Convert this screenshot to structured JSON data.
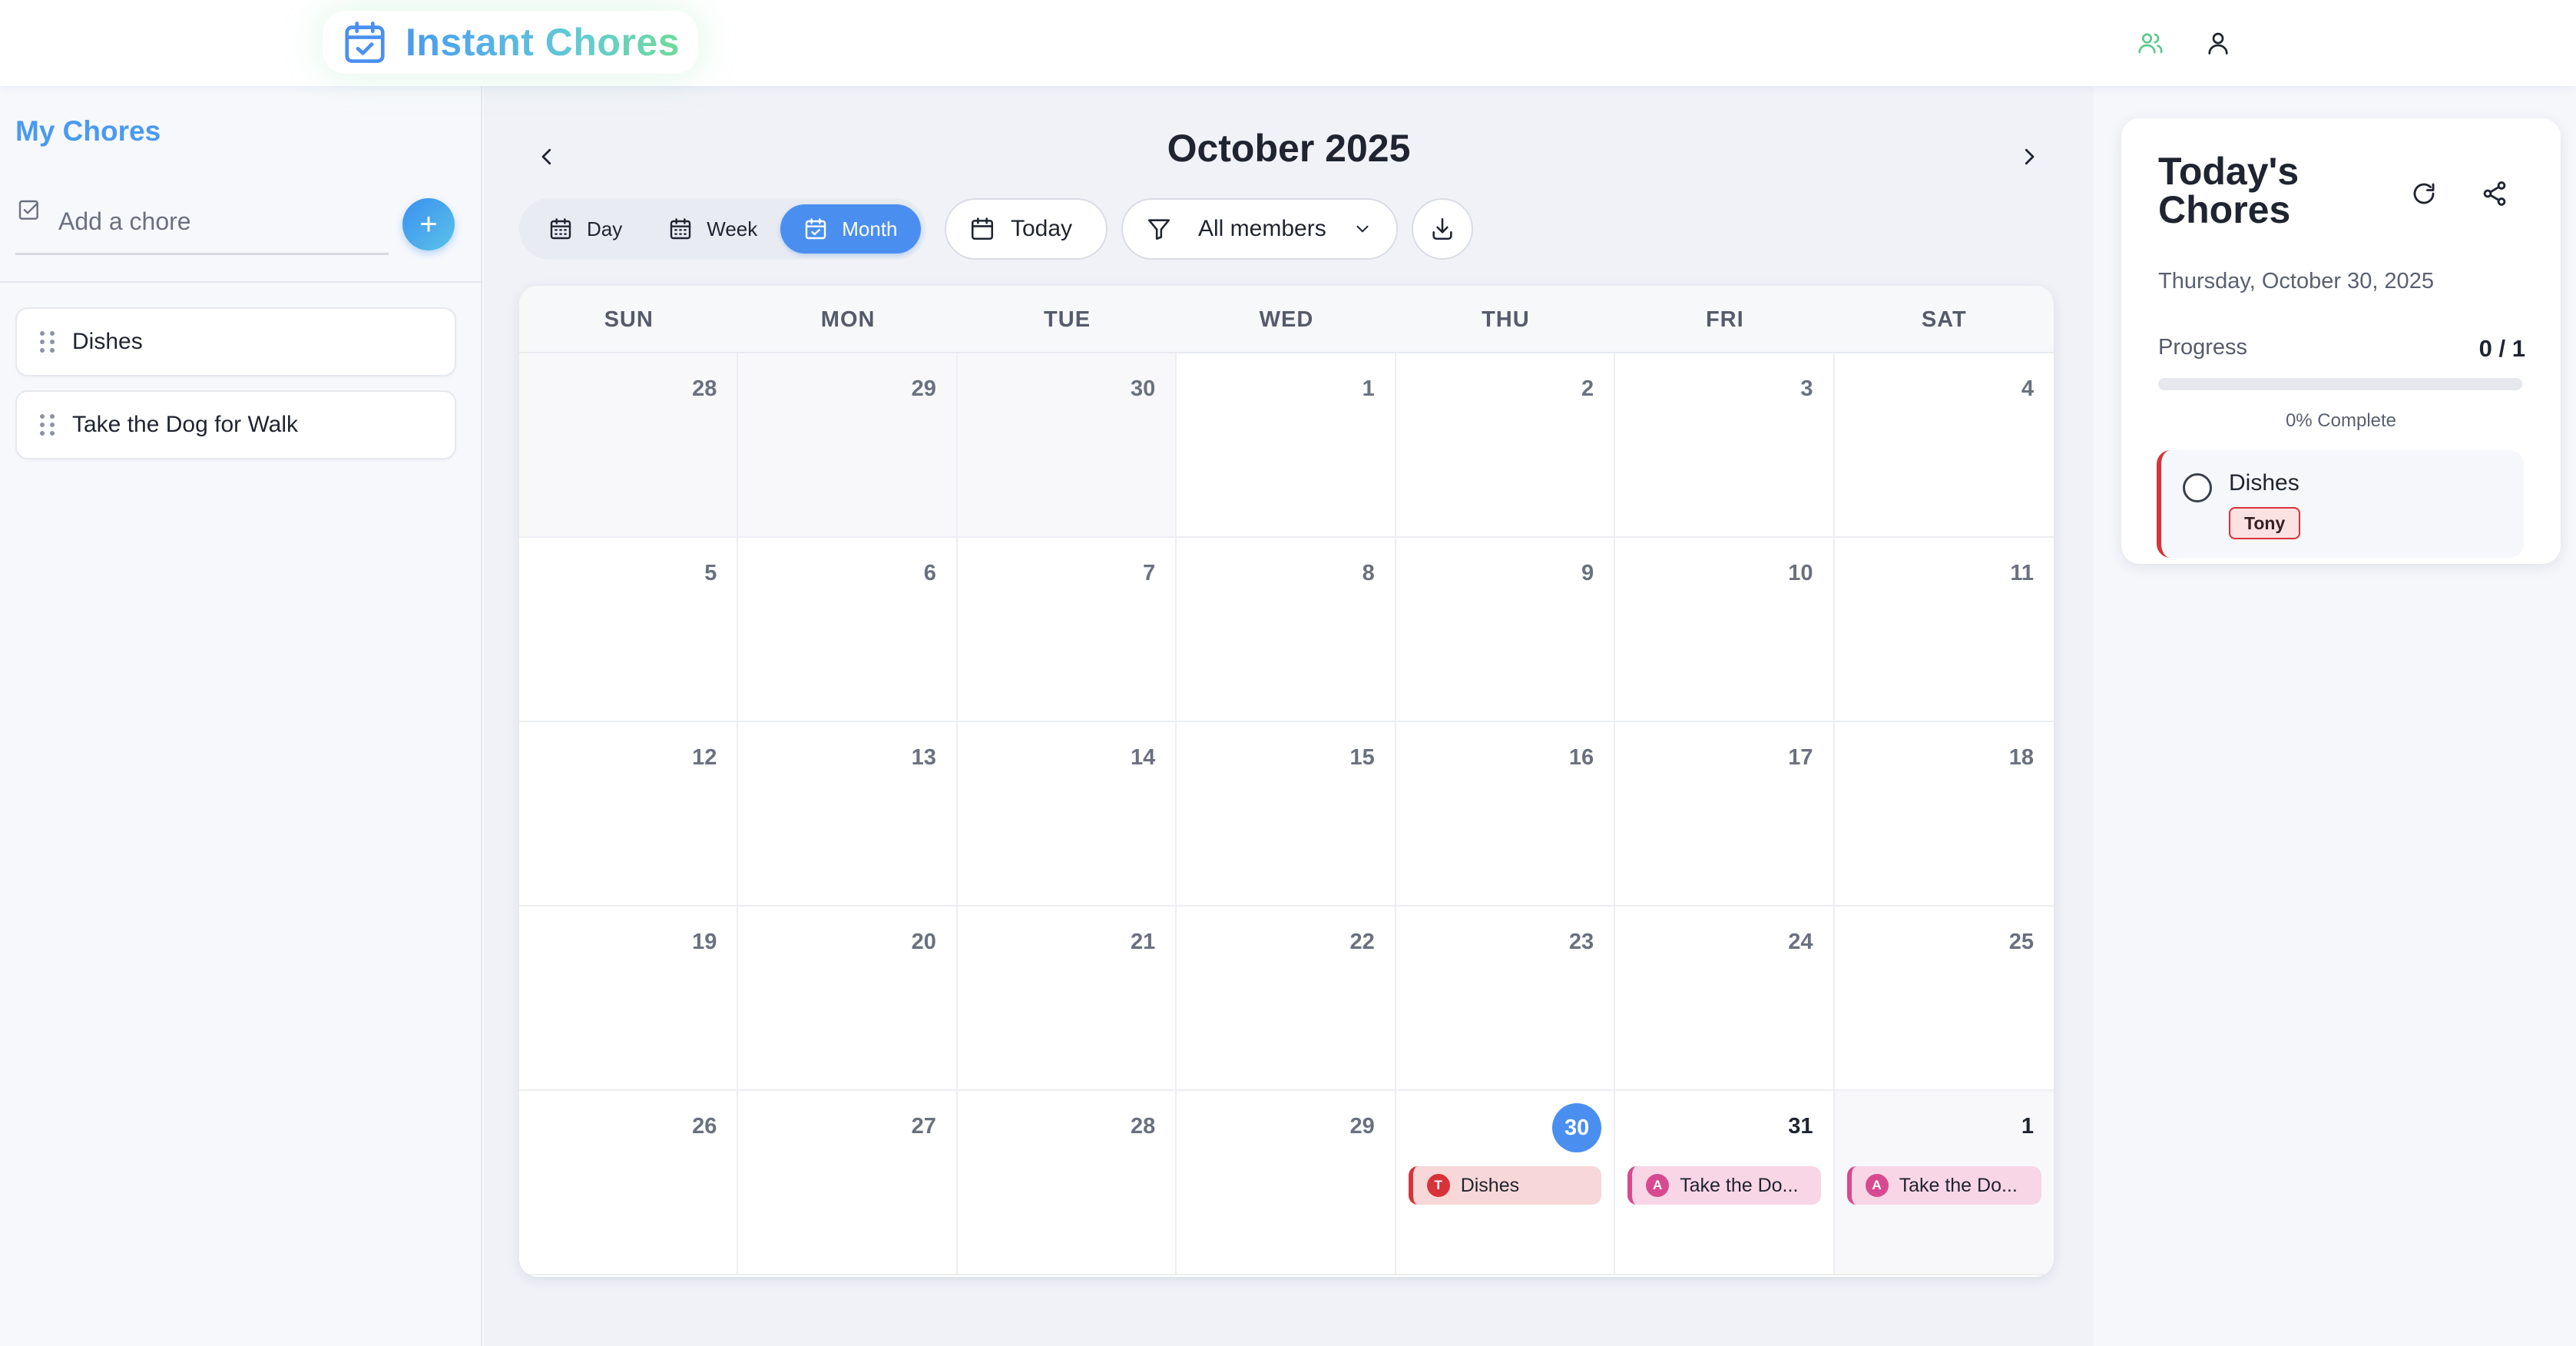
{
  "app": {
    "title": "Instant Chores"
  },
  "colors": {
    "accent": "#4a8ff0",
    "brand_green": "#6edc9a",
    "event_red": "#d8323a",
    "event_pink": "#d84a8f"
  },
  "sidebar": {
    "title": "My Chores",
    "add_placeholder": "Add a chore",
    "add_button": "+",
    "chores": [
      {
        "label": "Dishes"
      },
      {
        "label": "Take the Dog for Walk"
      }
    ]
  },
  "calendar": {
    "month_title": "October 2025",
    "views": {
      "day": "Day",
      "week": "Week",
      "month": "Month"
    },
    "active_view": "Month",
    "today_button": "Today",
    "filter_label": "All members",
    "weekdays": [
      "SUN",
      "MON",
      "TUE",
      "WED",
      "THU",
      "FRI",
      "SAT"
    ],
    "weeks": [
      [
        {
          "d": "28",
          "m": "prev"
        },
        {
          "d": "29",
          "m": "prev"
        },
        {
          "d": "30",
          "m": "prev"
        },
        {
          "d": "1",
          "m": "cur"
        },
        {
          "d": "2",
          "m": "cur"
        },
        {
          "d": "3",
          "m": "cur"
        },
        {
          "d": "4",
          "m": "cur"
        }
      ],
      [
        {
          "d": "5",
          "m": "cur"
        },
        {
          "d": "6",
          "m": "cur"
        },
        {
          "d": "7",
          "m": "cur"
        },
        {
          "d": "8",
          "m": "cur"
        },
        {
          "d": "9",
          "m": "cur"
        },
        {
          "d": "10",
          "m": "cur"
        },
        {
          "d": "11",
          "m": "cur"
        }
      ],
      [
        {
          "d": "12",
          "m": "cur"
        },
        {
          "d": "13",
          "m": "cur"
        },
        {
          "d": "14",
          "m": "cur"
        },
        {
          "d": "15",
          "m": "cur"
        },
        {
          "d": "16",
          "m": "cur"
        },
        {
          "d": "17",
          "m": "cur"
        },
        {
          "d": "18",
          "m": "cur"
        }
      ],
      [
        {
          "d": "19",
          "m": "cur"
        },
        {
          "d": "20",
          "m": "cur"
        },
        {
          "d": "21",
          "m": "cur"
        },
        {
          "d": "22",
          "m": "cur"
        },
        {
          "d": "23",
          "m": "cur"
        },
        {
          "d": "24",
          "m": "cur"
        },
        {
          "d": "25",
          "m": "cur"
        }
      ],
      [
        {
          "d": "26",
          "m": "cur"
        },
        {
          "d": "27",
          "m": "cur"
        },
        {
          "d": "28",
          "m": "cur"
        },
        {
          "d": "29",
          "m": "cur"
        },
        {
          "d": "30",
          "m": "today",
          "event": {
            "label": "Dishes",
            "initial": "T",
            "color": "red"
          }
        },
        {
          "d": "31",
          "m": "cur",
          "event": {
            "label": "Take the Do...",
            "initial": "A",
            "color": "pink"
          }
        },
        {
          "d": "1",
          "m": "next",
          "event": {
            "label": "Take the Do...",
            "initial": "A",
            "color": "pink"
          }
        }
      ]
    ]
  },
  "today_panel": {
    "title": "Today's Chores",
    "date": "Thursday, October 30, 2025",
    "progress_label": "Progress",
    "progress_count": "0 / 1",
    "progress_fraction": 0,
    "progress_percent_text": "0% Complete",
    "tasks": [
      {
        "name": "Dishes",
        "assignee": "Tony"
      }
    ]
  },
  "icons": {
    "brand": "calendar-check-icon",
    "members": "users-icon",
    "profile": "user-icon",
    "prev": "chevron-left-icon",
    "next": "chevron-right-icon",
    "filter": "filter-icon",
    "download": "download-icon",
    "refresh": "refresh-icon",
    "share": "share-icon"
  }
}
